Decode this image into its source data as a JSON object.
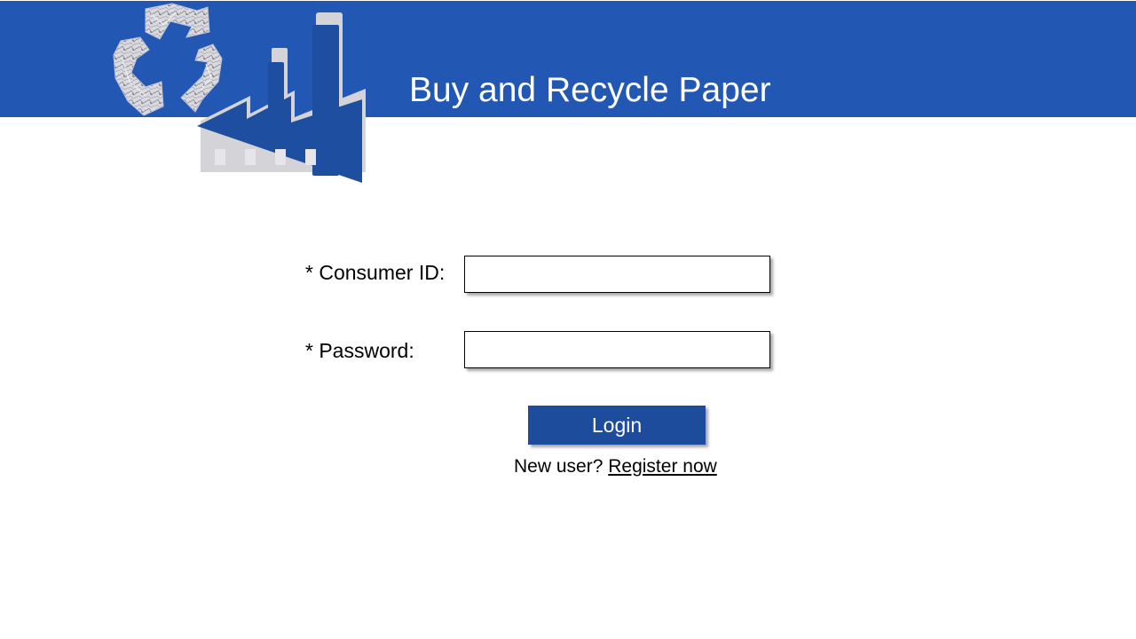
{
  "header": {
    "title": "Buy and Recycle Paper",
    "band_color": "#2257b4",
    "logo_icons": [
      "recycle-icon",
      "factory-icon"
    ]
  },
  "login_form": {
    "consumer_id_label": "* Consumer ID:",
    "consumer_id_value": "",
    "password_label": "* Password:",
    "password_value": "",
    "login_button_label": "Login",
    "button_color": "#1e4c9c"
  },
  "register": {
    "prompt": "New user?",
    "link_label": "Register now"
  }
}
